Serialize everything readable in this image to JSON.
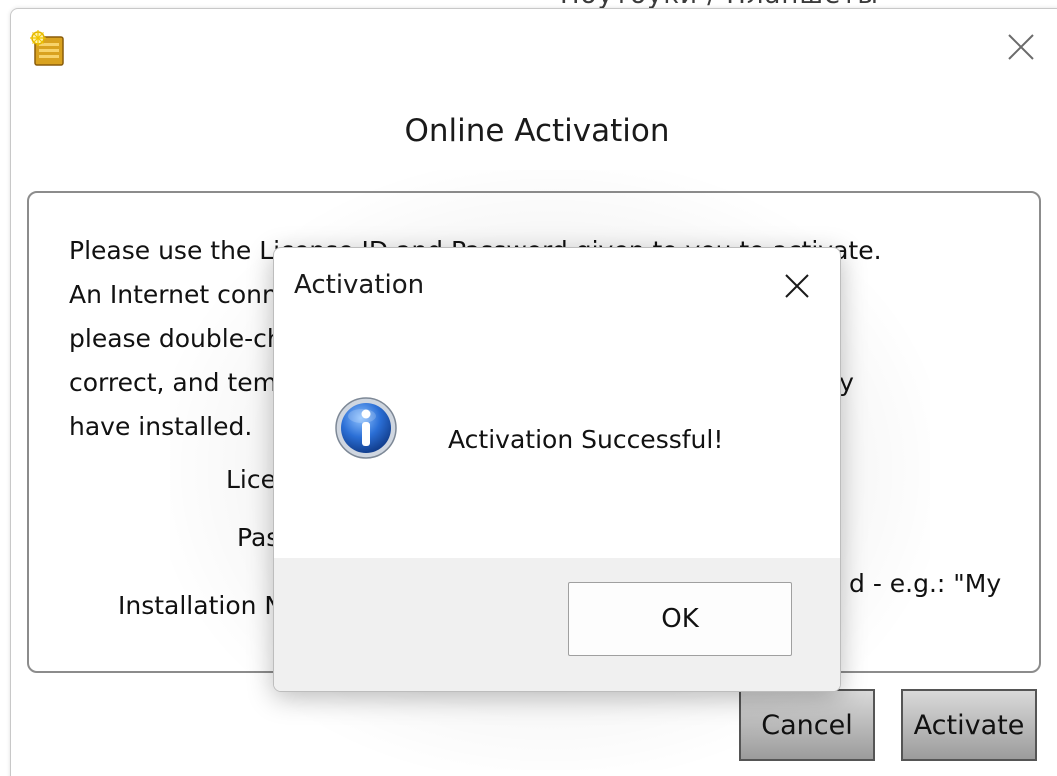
{
  "background": {
    "peek_text": "Ноутбуки / Планшеты"
  },
  "main_window": {
    "title": "Online Activation",
    "app_icon": "license-key-icon",
    "close_icon": "close-icon",
    "instructions": [
      "Please use the License ID and Password given to you to activate.",
      "An Internet connection is required. If you receive an error,",
      "please double-check that the License ID and Password are",
      "correct, and temporarily disable any firewall software you may",
      "have installed."
    ],
    "license_label": "License ID:",
    "password_label": "Password:",
    "installation_label": "Installation Name:",
    "installation_hint": "d - e.g.: \"My",
    "cancel_label": "Cancel",
    "activate_label": "Activate"
  },
  "modal": {
    "title": "Activation",
    "close_icon": "close-icon",
    "icon": "info-icon",
    "message": "Activation Successful!",
    "ok_label": "OK"
  },
  "colors": {
    "button_gradient_top": "#d9d9d9",
    "button_gradient_bottom": "#9c9c9c",
    "modal_footer": "#f0f0f0",
    "info_blue": "#1f5fbf"
  }
}
